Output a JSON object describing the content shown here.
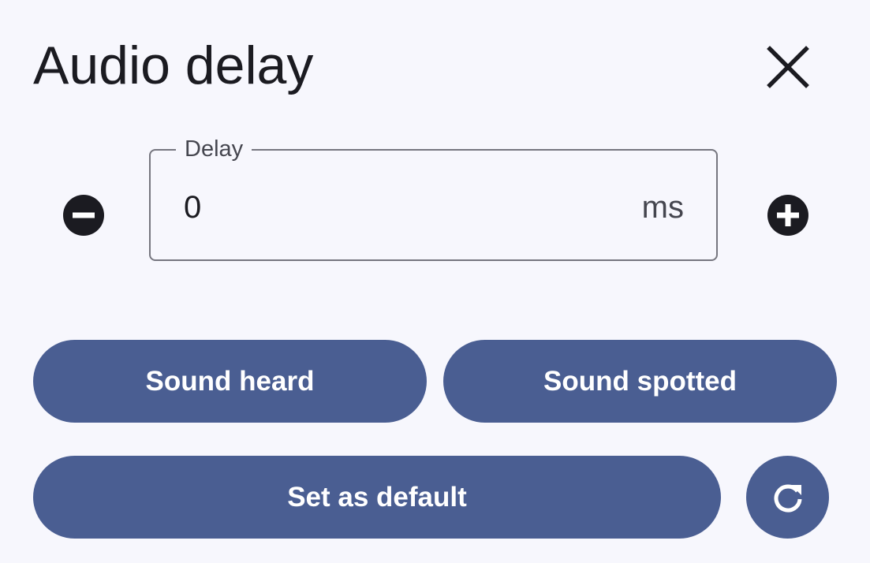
{
  "dialog": {
    "title": "Audio delay",
    "close_icon": "close-icon"
  },
  "delay_field": {
    "label": "Delay",
    "value": "0",
    "suffix": "ms",
    "decrement_icon": "minus-circle-icon",
    "increment_icon": "plus-circle-icon"
  },
  "actions": {
    "sound_heard_label": "Sound heard",
    "sound_spotted_label": "Sound spotted",
    "set_default_label": "Set as default",
    "reset_icon": "refresh-icon"
  },
  "colors": {
    "background": "#f7f7fd",
    "primary_button": "#4a5e92",
    "on_primary": "#ffffff",
    "text": "#1b1b21",
    "outline": "#76767f"
  }
}
